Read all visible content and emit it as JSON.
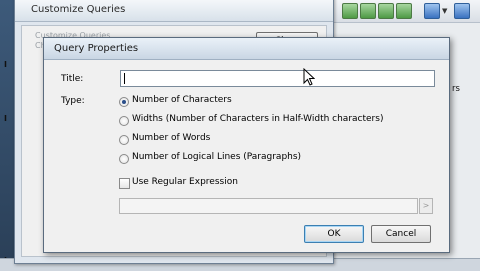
{
  "background": {
    "right_partial_text": "rs",
    "left_labels": [
      "I",
      "I",
      "I"
    ]
  },
  "customize_window": {
    "title": "Customize Queries",
    "ghost_lines": [
      "Customize Queries",
      "Characters"
    ],
    "close_label": "Close"
  },
  "dialog": {
    "title": "Query Properties",
    "title_label": "Title:",
    "title_value": "",
    "type_label": "Type:",
    "options": [
      {
        "label": "Number of Characters",
        "selected": true
      },
      {
        "label": "Widths (Number of Characters in Half-Width characters)",
        "selected": false
      },
      {
        "label": "Number of Words",
        "selected": false
      },
      {
        "label": "Number of Logical Lines (Paragraphs)",
        "selected": false
      }
    ],
    "regex_label": "Use Regular Expression",
    "regex_checked": false,
    "regex_value": "",
    "regex_button": ">",
    "ok_label": "OK",
    "cancel_label": "Cancel"
  },
  "colors": {
    "accent": "#3c7fb1",
    "title_bar": "#c9d6e4"
  },
  "icons": [
    "toolbar-green-icon",
    "toolbar-blue-icon",
    "dropdown-caret-icon",
    "mouse-pointer-icon"
  ]
}
